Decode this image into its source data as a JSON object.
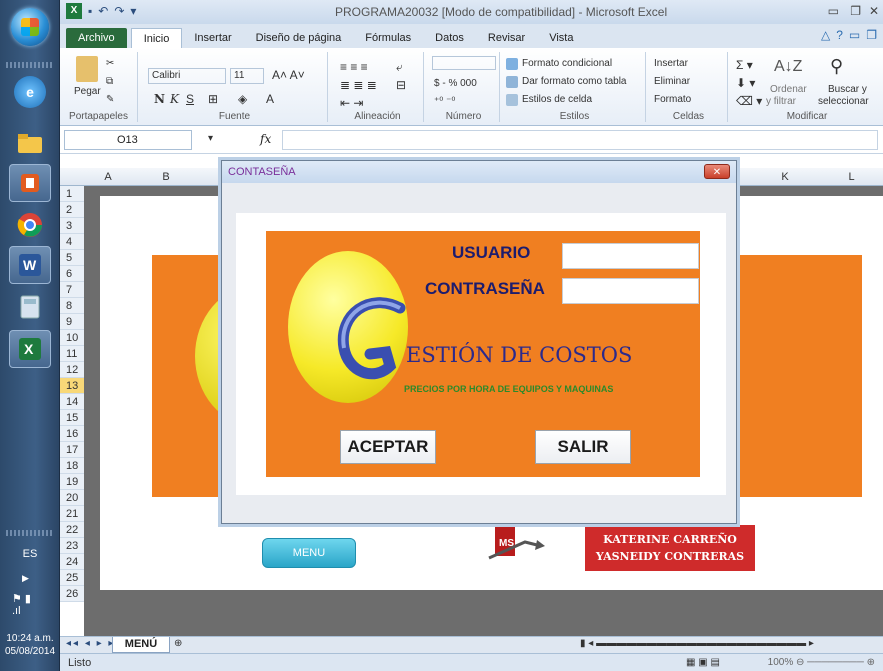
{
  "window": {
    "title": "PROGRAMA20032  [Modo de compatibilidad] - Microsoft Excel"
  },
  "taskbar": {
    "language": "ES",
    "time": "10:24 a.m.",
    "date": "05/08/2014",
    "items": [
      "internet-explorer",
      "file-explorer",
      "office",
      "chrome",
      "word",
      "calculator",
      "excel"
    ]
  },
  "ribbon": {
    "tabs": [
      "Archivo",
      "Inicio",
      "Insertar",
      "Diseño de página",
      "Fórmulas",
      "Datos",
      "Revisar",
      "Vista"
    ],
    "active_tab": "Inicio",
    "paste": "Pegar",
    "font_name": "Calibri",
    "font_size": "11",
    "bold": "N",
    "italic": "K",
    "underline": "S",
    "number_format": "$ - % 000",
    "cond_format": "Formato condicional",
    "format_table": "Dar formato como tabla",
    "cell_styles": "Estilos de celda",
    "insert": "Insertar",
    "delete": "Eliminar",
    "format": "Formato",
    "sort": "Ordenar",
    "filter": "y filtrar",
    "find": "Buscar y",
    "select": "seleccionar",
    "groups": [
      "Portapapeles",
      "Fuente",
      "Alineación",
      "Número",
      "Estilos",
      "Celdas",
      "Modificar"
    ]
  },
  "formula_bar": {
    "name_box": "O13",
    "fx": "fx",
    "formula": ""
  },
  "grid": {
    "columns": [
      "A",
      "B",
      "K",
      "L"
    ],
    "rows": [
      "1",
      "2",
      "3",
      "4",
      "5",
      "6",
      "7",
      "8",
      "9",
      "10",
      "11",
      "12",
      "13",
      "14",
      "15",
      "16",
      "17",
      "18",
      "19",
      "20",
      "21",
      "22",
      "23",
      "24",
      "25",
      "26"
    ],
    "selected_row": "13"
  },
  "sheet": {
    "menu_button": "MENU",
    "authors_line1": "KATERINE CARREÑO",
    "authors_line2": "YASNEIDY CONTRERAS",
    "tab_name": "MENÚ"
  },
  "status": {
    "text": "Listo",
    "zoom": "100%"
  },
  "dialog": {
    "title": "CONTASEÑA",
    "close": "✕",
    "user_label": "USUARIO",
    "password_label": "CONTRASEÑA",
    "user_value": "",
    "password_value": "",
    "logo_title": "ESTIÓN DE COSTOS",
    "logo_subtitle": "PRECIOS POR HORA DE EQUIPOS Y MAQUINAS",
    "accept": "ACEPTAR",
    "exit": "SALIR"
  },
  "colors": {
    "orange": "#f07f21",
    "yellow": "#f6e928",
    "navy_label": "#1c1c6e",
    "author_red": "#cf2b2b",
    "excel_green": "#2a6b3c"
  }
}
